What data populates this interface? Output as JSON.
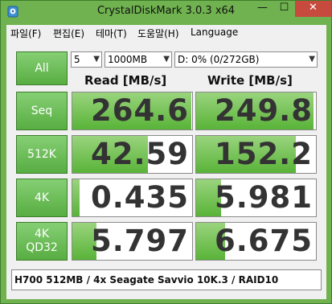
{
  "window": {
    "title": "CrystalDiskMark 3.0.3 x64",
    "min_label": "—",
    "max_label": "☐",
    "close_label": "✕"
  },
  "menu": [
    "파일(F)",
    "편집(E)",
    "테마(T)",
    "도움말(H)",
    "Language"
  ],
  "controls": {
    "all_label": "All",
    "count_value": "5",
    "size_value": "1000MB",
    "drive_value": "D: 0% (0/272GB)"
  },
  "headers": {
    "read": "Read [MB/s]",
    "write": "Write [MB/s]"
  },
  "rows": [
    {
      "label": "Seq",
      "read": "264.6",
      "write": "249.8",
      "read_fill": 0.99,
      "write_fill": 0.98
    },
    {
      "label": "512K",
      "read": "42.59",
      "write": "152.2",
      "read_fill": 0.63,
      "write_fill": 0.83
    },
    {
      "label": "4K",
      "read": "0.435",
      "write": "5.981",
      "read_fill": 0.06,
      "write_fill": 0.21
    },
    {
      "label_line1": "4K",
      "label_line2": "QD32",
      "read": "5.797",
      "write": "6.675",
      "read_fill": 0.2,
      "write_fill": 0.24
    }
  ],
  "comment": "H700 512MB / 4x Seagate Savvio 10K.3 / RAID10",
  "colors": {
    "accent_green": "#6fb24f",
    "bar_green": "#5cb33a",
    "close_red": "#c74a3e"
  }
}
